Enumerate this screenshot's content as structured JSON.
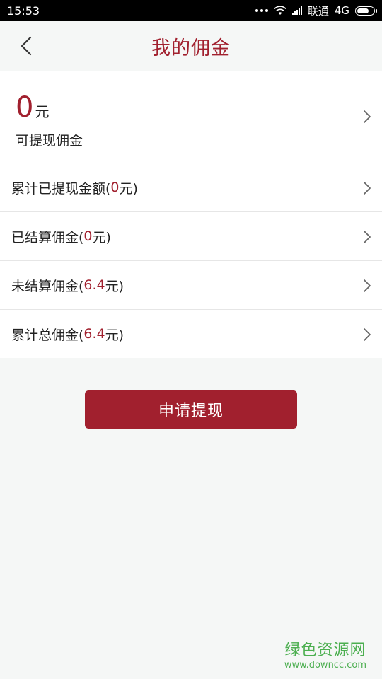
{
  "status_bar": {
    "time": "15:53",
    "carrier": "联通",
    "network": "4G"
  },
  "nav": {
    "title": "我的佣金"
  },
  "summary": {
    "amount": "0",
    "unit": "元",
    "label": "可提现佣金"
  },
  "items": [
    {
      "prefix": "累计已提现金额(",
      "value": "0",
      "suffix": "元)"
    },
    {
      "prefix": "已结算佣金(",
      "value": "0",
      "suffix": "元)"
    },
    {
      "prefix": "未结算佣金(",
      "value": "6.4",
      "suffix": "元)"
    },
    {
      "prefix": "累计总佣金(",
      "value": "6.4",
      "suffix": "元)"
    }
  ],
  "withdraw_button": {
    "label": "申请提现"
  },
  "watermark": {
    "name": "绿色资源网",
    "url": "www.downcc.com"
  },
  "colors": {
    "accent": "#a1202e",
    "background": "#f5f7f6",
    "watermark": "#4caf50"
  }
}
